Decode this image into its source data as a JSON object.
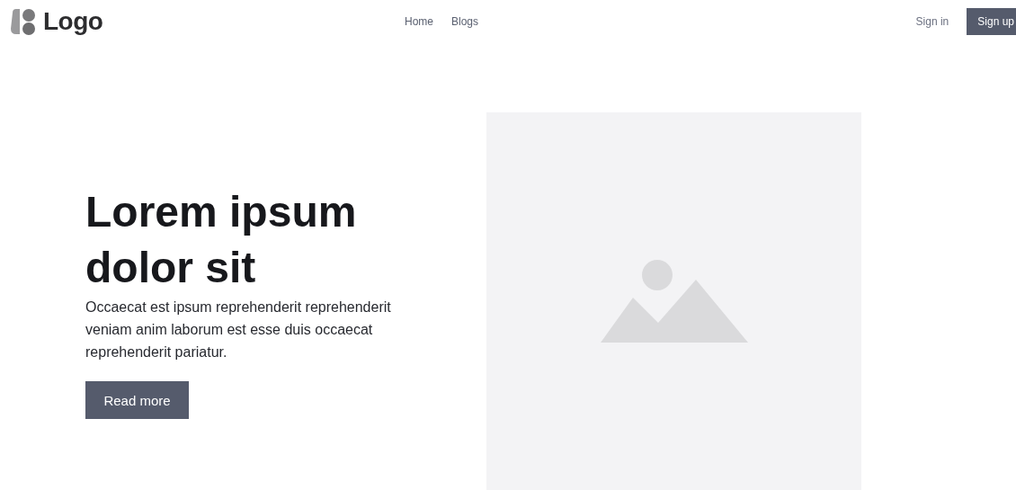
{
  "header": {
    "logo": "Logo",
    "nav": [
      {
        "label": "Home"
      },
      {
        "label": "Blogs"
      }
    ],
    "sign_in": "Sign in",
    "sign_up": "Sign up"
  },
  "hero": {
    "heading": "Lorem ipsum dolor sit",
    "text": "Occaecat est ipsum reprehenderit reprehenderit veniam anim laborum est esse duis occaecat reprehenderit pariatur.",
    "button": "Read more",
    "image": {
      "kind": "placeholder"
    }
  }
}
